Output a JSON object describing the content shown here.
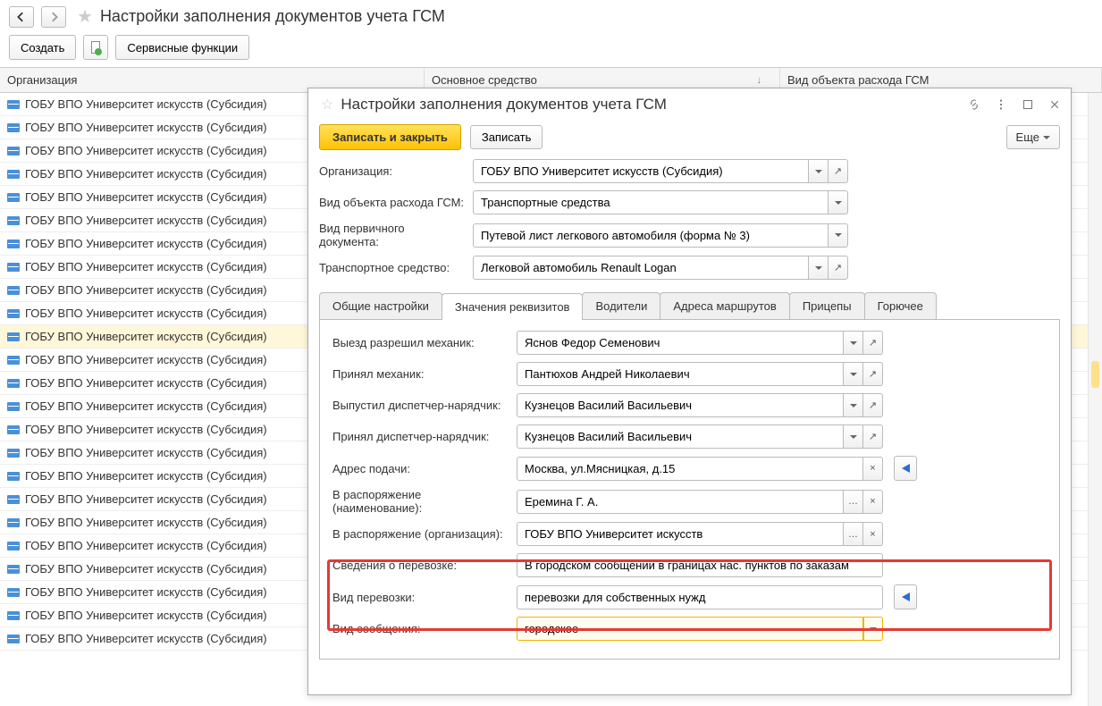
{
  "page": {
    "title": "Настройки заполнения документов учета ГСМ"
  },
  "toolbar": {
    "create": "Создать",
    "service": "Сервисные функции"
  },
  "table": {
    "columns": {
      "org": "Организация",
      "asset": "Основное средство",
      "type": "Вид объекта расхода ГСМ"
    },
    "row_text": "ГОБУ ВПО Университет искусств (Субсидия)"
  },
  "dialog": {
    "title": "Настройки заполнения документов учета ГСМ",
    "btn_write_close": "Записать и закрыть",
    "btn_write": "Записать",
    "btn_more": "Еще",
    "fields": {
      "org_label": "Организация:",
      "org_value": "ГОБУ ВПО Университет искусств (Субсидия)",
      "type_label": "Вид объекта расхода ГСМ:",
      "type_value": "Транспортные средства",
      "doc_label": "Вид первичного документа:",
      "doc_value": "Путевой лист легкового автомобиля (форма № 3)",
      "vehicle_label": "Транспортное средство:",
      "vehicle_value": "Легковой автомобиль Renault Logan"
    },
    "tabs": {
      "general": "Общие настройки",
      "values": "Значения реквизитов",
      "drivers": "Водители",
      "routes": "Адреса маршрутов",
      "trailers": "Прицепы",
      "fuel": "Горючее"
    },
    "values": {
      "depart_label": "Выезд разрешил механик:",
      "depart_value": "Яснов Федор Семенович",
      "accept_label": "Принял механик:",
      "accept_value": "Пантюхов Андрей Николаевич",
      "dispatch_out_label": "Выпустил диспетчер-нарядчик:",
      "dispatch_out_value": "Кузнецов Василий Васильевич",
      "dispatch_in_label": "Принял диспетчер-нарядчик:",
      "dispatch_in_value": "Кузнецов Василий Васильевич",
      "address_label": "Адрес подачи:",
      "address_value": "Москва, ул.Мясницкая, д.15",
      "disposal_name_label": "В распоряжение (наименование):",
      "disposal_name_value": "Еремина Г. А.",
      "disposal_org_label": "В распоряжение (организация):",
      "disposal_org_value": "ГОБУ ВПО Университет искусств",
      "transport_info_label": "Сведения о перевозке:",
      "transport_info_value": "В городском сообщении в границах нас. пунктов по заказам",
      "transport_kind_label": "Вид перевозки:",
      "transport_kind_value": "перевозки для собственных нужд",
      "comm_kind_label": "Вид сообщения:",
      "comm_kind_value": "городское"
    }
  }
}
